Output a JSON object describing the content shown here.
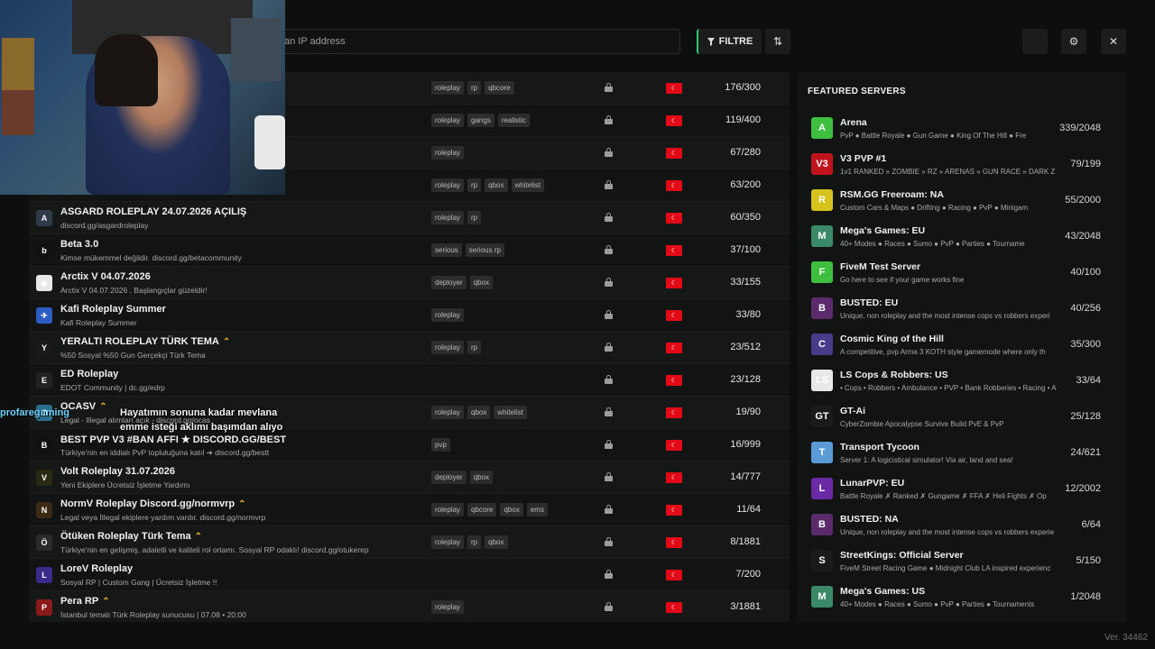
{
  "search": {
    "placeholder": "an IP address"
  },
  "toolbar": {
    "filter_label": "FILTRE",
    "sort_icon": "sort-icon"
  },
  "window": {
    "settings_icon": "gear-icon",
    "close_icon": "close-icon"
  },
  "servers": [
    {
      "name": "",
      "desc": "",
      "tags": [
        "roleplay",
        "rp",
        "qbcore"
      ],
      "players": "176/300",
      "icon": "",
      "icon_color": "#3a3a3a"
    },
    {
      "name": "",
      "desc": "",
      "tags": [
        "roleplay",
        "gangs",
        "realistic"
      ],
      "players": "119/400",
      "icon": "",
      "icon_color": "#3a3a3a"
    },
    {
      "name": "",
      "desc": "",
      "tags": [
        "roleplay"
      ],
      "players": "67/280",
      "icon": "",
      "icon_color": "#3a3a3a"
    },
    {
      "name": "",
      "desc": "",
      "tags": [
        "roleplay",
        "rp",
        "qbox",
        "whitelist"
      ],
      "players": "63/200",
      "icon": "",
      "icon_color": "#3a3a3a"
    },
    {
      "name": "ASGARD ROLEPLAY 24.07.2026 AÇILIŞ",
      "desc": "discord.gg/asgardroleplay",
      "tags": [
        "roleplay",
        "rp"
      ],
      "players": "60/350",
      "icon": "A",
      "icon_color": "#2f3a4a",
      "boost": false
    },
    {
      "name": "Beta 3.0",
      "desc": "Kimse mükemmel değildir. discord.gg/betacommunity",
      "tags": [
        "serious",
        "serious rp"
      ],
      "players": "37/100",
      "icon": "b",
      "icon_color": "#111111",
      "boost": false
    },
    {
      "name": "Arctix V 04.07.2026",
      "desc": "Arctix V 04.07.2026 . Başlangıçlar güzeldir!",
      "tags": [
        "deployer",
        "qbox"
      ],
      "players": "33/155",
      "icon": "◆",
      "icon_color": "#e8e8e8",
      "boost": false
    },
    {
      "name": "Kafi Roleplay Summer",
      "desc": "Kafi Roleplay Summer",
      "tags": [
        "roleplay"
      ],
      "players": "33/80",
      "icon": "✈",
      "icon_color": "#2a5dbf",
      "boost": false
    },
    {
      "name": "YERALTI ROLEPLAY TÜRK TEMA",
      "desc": "%50 Sosyal %50 Gun Gerçekçi Türk Tema",
      "tags": [
        "roleplay",
        "rp"
      ],
      "players": "23/512",
      "icon": "Y",
      "icon_color": "#1a1a1a",
      "boost": true
    },
    {
      "name": "ED Roleplay",
      "desc": "EDOT Community | dc.gg/edrp",
      "tags": [],
      "players": "23/128",
      "icon": "E",
      "icon_color": "#222222",
      "boost": false
    },
    {
      "name": "OCASV",
      "desc": "Legal - Illegal alımları açık - discord.gg/ocas",
      "tags": [
        "roleplay",
        "qbox",
        "whitelist"
      ],
      "players": "19/90",
      "icon": "O",
      "icon_color": "#2b6f8f",
      "boost": true
    },
    {
      "name": "BEST PVP V3 #BAN AFFI ★ DISCORD.GG/BEST",
      "desc": "Türkiye'nin en iddialı PvP topluluğuna katıl ➜ discord.gg/bestt",
      "tags": [
        "pvp"
      ],
      "players": "16/999",
      "icon": "B",
      "icon_color": "#111111",
      "boost": false
    },
    {
      "name": "Volt Roleplay 31.07.2026",
      "desc": "Yeni Ekiplere Ücretsiz İşletme Yardımı",
      "tags": [
        "deployer",
        "qbox"
      ],
      "players": "14/777",
      "icon": "V",
      "icon_color": "#2a2a14",
      "boost": false
    },
    {
      "name": "NormV Roleplay Discord.gg/normvrp",
      "desc": "Legal veya İllegal ekiplere yardım vardır. discord.gg/normvrp",
      "tags": [
        "roleplay",
        "qbcore",
        "qbox",
        "ems"
      ],
      "players": "11/64",
      "icon": "N",
      "icon_color": "#3a2a14",
      "boost": true
    },
    {
      "name": "Ötüken Roleplay Türk Tema",
      "desc": "Türkiye'nin en gelişmiş, adaletli ve kaliteli rol ortamı. Sosyal RP odaklı! discord.gg/otukenrp",
      "tags": [
        "roleplay",
        "rp",
        "qbox"
      ],
      "players": "8/1881",
      "icon": "Ö",
      "icon_color": "#2a2a2a",
      "boost": true
    },
    {
      "name": "LoreV Roleplay",
      "desc": "Sosyal RP | Custom Gang | Ücretsiz İşletme !!",
      "tags": [],
      "players": "7/200",
      "icon": "L",
      "icon_color": "#3a2a8a",
      "boost": false
    },
    {
      "name": "Pera RP",
      "desc": "İstanbul temalı Türk Roleplay sunucusu | 07.08 • 20:00",
      "tags": [
        "roleplay"
      ],
      "players": "3/1881",
      "icon": "P",
      "icon_color": "#8a1a1a",
      "boost": true
    }
  ],
  "featured": {
    "title": "FEATURED SERVERS",
    "items": [
      {
        "name": "Arena",
        "desc": "PvP ● Battle Royale ● Gun Game ● King Of The Hill ● Fre",
        "players": "339/2048",
        "icon": "A",
        "icon_color": "#3fbf3f"
      },
      {
        "name": "V3 PVP #1",
        "desc": "1v1 RANKED » ZOMBIE » RZ » ARENAS » GUN RACE » DARK Z",
        "players": "79/199",
        "icon": "V3",
        "icon_color": "#c0141c"
      },
      {
        "name": "RSM.GG Freeroam: NA",
        "desc": "Custom Cars & Maps ● Drifting ● Racing ● PvP ● Minigam",
        "players": "55/2000",
        "icon": "R",
        "icon_color": "#d6c21a"
      },
      {
        "name": "Mega's Games: EU",
        "desc": "40+ Modes ● Races ● Sumo ● PvP ● Parties ● Tourname",
        "players": "43/2048",
        "icon": "M",
        "icon_color": "#3a8a6a"
      },
      {
        "name": "FiveM Test Server",
        "desc": "Go here to see if your game works fine",
        "players": "40/100",
        "icon": "F",
        "icon_color": "#3fbf3f"
      },
      {
        "name": "BUSTED: EU",
        "desc": "Unique, non roleplay and the most intense cops vs robbers experi",
        "players": "40/256",
        "icon": "B",
        "icon_color": "#5a2a6a"
      },
      {
        "name": "Cosmic King of the Hill",
        "desc": "A competitive, pvp Arma 3 KOTH style gamemode where only th",
        "players": "35/300",
        "icon": "C",
        "icon_color": "#4a3a8a"
      },
      {
        "name": "LS Cops & Robbers: US",
        "desc": "• Cops • Robbers • Ambulance • PVP • Bank Robberies • Racing • A",
        "players": "33/64",
        "icon": "LS",
        "icon_color": "#e8e8e8"
      },
      {
        "name": "GT-Ai",
        "desc": "CyberZombie Apocalypse Survive Build PvE & PvP",
        "players": "25/128",
        "icon": "GT",
        "icon_color": "#1a1a1a"
      },
      {
        "name": "Transport Tycoon",
        "desc": "Server 1: A logicistical simulator! Via air, land and sea!",
        "players": "24/621",
        "icon": "T",
        "icon_color": "#5a9ad6"
      },
      {
        "name": "LunarPVP: EU",
        "desc": "Battle Royale ✗ Ranked ✗ Gungame ✗ FFA ✗ Heli Fights ✗ Op",
        "players": "12/2002",
        "icon": "L",
        "icon_color": "#6a2aa6"
      },
      {
        "name": "BUSTED: NA",
        "desc": "Unique, non roleplay and the most intense cops vs robbers experie",
        "players": "6/64",
        "icon": "B",
        "icon_color": "#5a2a6a"
      },
      {
        "name": "StreetKings: Official Server",
        "desc": "FiveM Street Racing Game ● Midnight Club LA inspired experienc",
        "players": "5/150",
        "icon": "S",
        "icon_color": "#1a1a1a"
      },
      {
        "name": "Mega's Games: US",
        "desc": "40+ Modes ● Races ● Sumo ● PvP ● Parties ● Tournaments",
        "players": "1/2048",
        "icon": "M",
        "icon_color": "#3a8a6a"
      }
    ]
  },
  "version": "Ver. 34462",
  "overlay": {
    "chat_user": "profaregaming",
    "line1": "Hayatımın sonuna kadar mevlana",
    "line2": "emme isteği aklımı başımdan alıyo"
  }
}
